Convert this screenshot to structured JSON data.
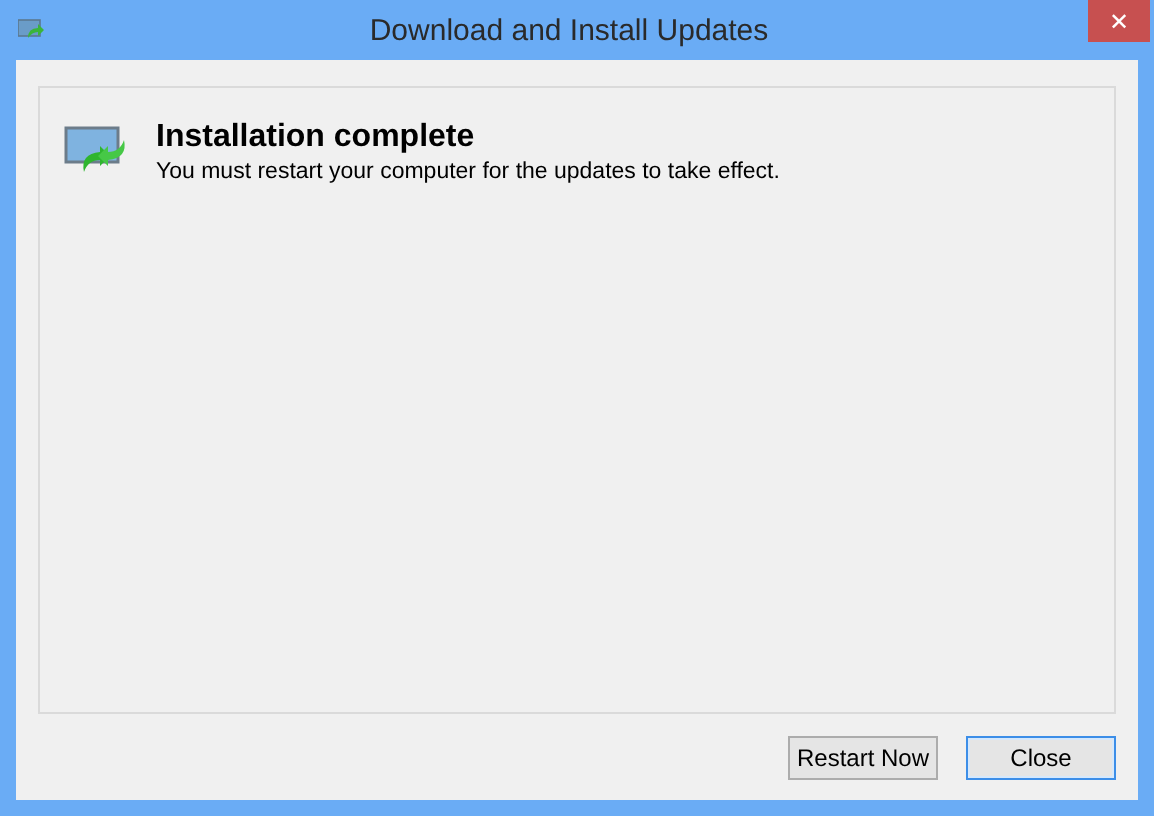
{
  "window": {
    "title": "Download and Install Updates",
    "close_glyph": "✕"
  },
  "message": {
    "heading": "Installation complete",
    "body": "You must restart your computer for the updates to take effect."
  },
  "buttons": [
    {
      "label": "Restart Now",
      "default": false
    },
    {
      "label": "Close",
      "default": true
    }
  ]
}
